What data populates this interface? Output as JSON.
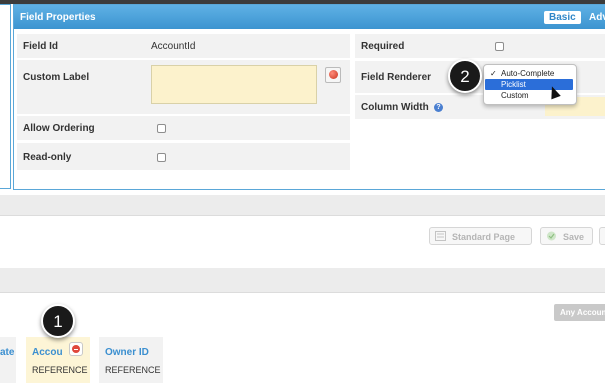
{
  "panel": {
    "title": "Field Properties",
    "basic_label": "Basic",
    "advanced_label": "Adv"
  },
  "fields": {
    "field_id_label": "Field Id",
    "field_id_value": "AccountId",
    "custom_label_label": "Custom Label",
    "custom_label_value": "",
    "allow_ordering_label": "Allow Ordering",
    "read_only_label": "Read-only",
    "required_label": "Required",
    "field_renderer_label": "Field Renderer",
    "column_width_label": "Column Width"
  },
  "dropdown": {
    "options": [
      "Auto-Complete",
      "Picklist",
      "Custom"
    ],
    "checked": "Auto-Complete",
    "highlighted": "Picklist",
    "check_glyph": "✓"
  },
  "markers": {
    "one": "1",
    "two": "2"
  },
  "toolbar": {
    "standard_page_label": "Standard Page",
    "save_label": "Save"
  },
  "columns_area": {
    "any_account_label": "Any Account",
    "columns": [
      {
        "title": "ate",
        "type": ""
      },
      {
        "title": "Accou",
        "type": "REFERENCE"
      },
      {
        "title": "Owner ID",
        "type": "REFERENCE"
      }
    ]
  },
  "colors": {
    "header_blue": "#3c94d0",
    "textarea_yellow": "#fcf2cc",
    "selection_blue": "#2b6ed9",
    "link_blue": "#3b8fd0"
  },
  "icons": [
    "translate-icon",
    "help-icon",
    "cursor-arrow-icon",
    "remove-icon",
    "page-icon",
    "save-check-icon"
  ]
}
